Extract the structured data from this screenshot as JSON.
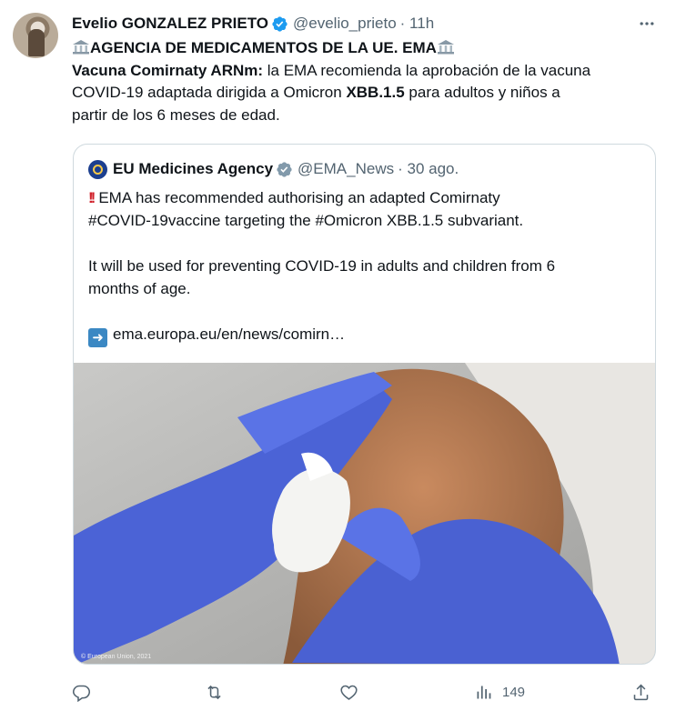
{
  "tweet": {
    "author_name": "Evelio GONZALEZ PRIETO",
    "author_handle": "@evelio_prieto",
    "time": "· 11h",
    "heading": "AGENCIA DE MEDICAMENTOS DE LA UE. EMA",
    "body_bold_1": "Vacuna Comirnaty ARNm:",
    "body_1": " la EMA recomienda la aprobación de la vacuna",
    "body_2a": "COVID-19 adaptada dirigida a Omicron ",
    "body_bold_2": "XBB.1.5",
    "body_2b": " para adultos y niños a",
    "body_3": "partir de los 6 meses de edad."
  },
  "quote": {
    "author_name": "EU Medicines Agency",
    "author_handle": "@EMA_News",
    "time": "· 30 ago.",
    "line_1": "EMA has recommended authorising an adapted Comirnaty",
    "line_2": "#COVID-19vaccine targeting the #Omicron XBB.1.5 subvariant.",
    "line_3": "It will be used for preventing COVID-19 in adults and children from 6",
    "line_4": "months of age.",
    "link": "ema.europa.eu/en/news/comirn…",
    "image_credit": "© European Union, 2021"
  },
  "actions": {
    "views": "149"
  },
  "colors": {
    "text": "#0f1419",
    "muted": "#536471",
    "verified": "#1d9bf0",
    "border": "#cfd9de",
    "glove": "#4b63d6"
  },
  "icons": [
    "more-icon",
    "verified-icon",
    "bank-icon",
    "reply-icon",
    "retweet-icon",
    "like-icon",
    "views-icon",
    "share-icon"
  ]
}
